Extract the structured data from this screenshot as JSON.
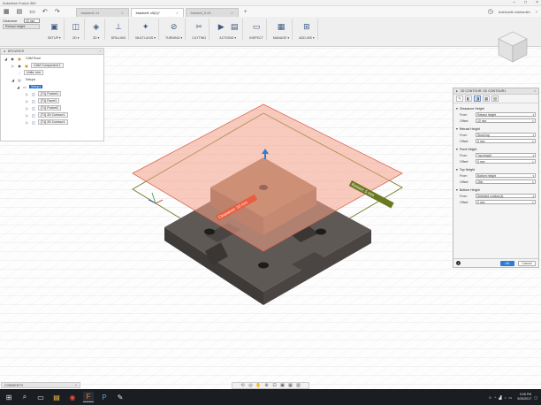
{
  "window": {
    "title": "Autodesk Fusion 360"
  },
  "tabs": [
    {
      "label": "bracket1 v1"
    },
    {
      "label": "bracket1 v5(1)*"
    },
    {
      "label": "bracket_5 v5"
    }
  ],
  "user": {
    "name": "Adelsmith Adelsmith"
  },
  "toolbar": {
    "clearance": {
      "label": "Clearance",
      "value": "10 mm",
      "height_label": "Retract height"
    },
    "groups": [
      {
        "label": "SETUP ▾"
      },
      {
        "label": "2D ▾"
      },
      {
        "label": "3D ▾"
      },
      {
        "label": "DRILLING"
      },
      {
        "label": "MULTI-AXIS ▾"
      },
      {
        "label": "TURNING ▾"
      },
      {
        "label": "CUTTING"
      },
      {
        "label": "ACTIONS ▾"
      },
      {
        "label": "INSPECT"
      },
      {
        "label": "MANAGE ▾"
      },
      {
        "label": "ADD-INS ▾"
      }
    ]
  },
  "browser": {
    "title": "BROWSER",
    "items": [
      {
        "label": "CAM Root"
      },
      {
        "label": "CAM Component 1"
      },
      {
        "label": "Units: mm"
      },
      {
        "label": "Setups"
      },
      {
        "label": "Setup1"
      },
      {
        "label": "[T1] Pocket1"
      },
      {
        "label": "[T1] Facet1"
      },
      {
        "label": "[T1] Pocket2"
      },
      {
        "label": "[T1] 2D Contour1"
      },
      {
        "label": "[T1] 2D Contour1"
      }
    ]
  },
  "viewport": {
    "label_clearance": "Clearance: 10 mm",
    "label_retract": "Retract: 5 mm"
  },
  "panel": {
    "title": "2D CONTOUR: 2D CONTOUR1",
    "sections": [
      {
        "title": "Clearance Height",
        "from_label": "From",
        "from": "Retract height",
        "offset_label": "Offset",
        "offset": "10 mm"
      },
      {
        "title": "Retract Height",
        "from_label": "From",
        "from": "Stock top",
        "offset_label": "Offset",
        "offset": "5 mm"
      },
      {
        "title": "Feed Height",
        "from_label": "From",
        "from": "Top height",
        "offset_label": "Offset",
        "offset": "5 mm"
      },
      {
        "title": "Top Height",
        "from_label": "From",
        "from": "Bottom height",
        "offset_label": "Offset",
        "offset": "25in"
      },
      {
        "title": "Bottom Height",
        "from_label": "From",
        "from": "Selected contour(s)",
        "offset_label": "Offset",
        "offset": "0 mm"
      }
    ],
    "ok": "OK",
    "cancel": "Cancel"
  },
  "comments": {
    "label": "COMMENTS"
  },
  "taskbar": {
    "time": "9:26 PM",
    "date": "9/25/2017"
  },
  "colors": {
    "accent": "#2c7cd6",
    "plane": "#f2a088",
    "part": "#5b5550",
    "stock": "#a07b63"
  }
}
